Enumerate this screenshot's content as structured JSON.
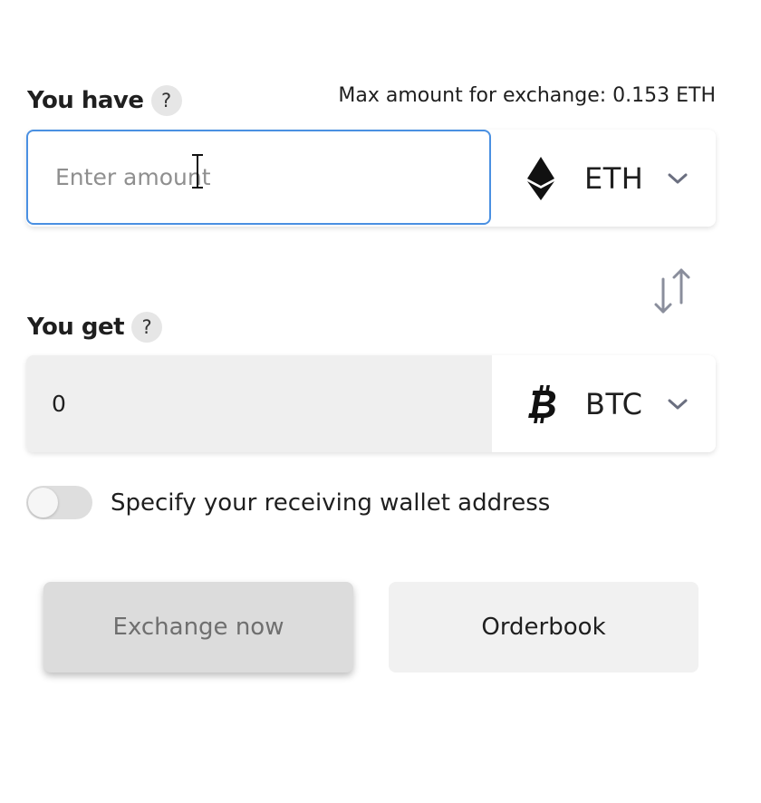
{
  "you_have": {
    "label": "You have",
    "help": "?",
    "max_amount": "Max amount for exchange: 0.153 ETH",
    "input_placeholder": "Enter amount",
    "input_value": "",
    "currency": {
      "code": "ETH",
      "icon": "ethereum-icon"
    }
  },
  "you_get": {
    "label": "You get",
    "help": "?",
    "amount": "0",
    "currency": {
      "code": "BTC",
      "icon": "bitcoin-icon"
    }
  },
  "swap": {
    "icon": "swap-arrows-icon"
  },
  "wallet_toggle": {
    "label": "Specify your receiving wallet address",
    "enabled": false
  },
  "buttons": {
    "exchange_label": "Exchange now",
    "orderbook_label": "Orderbook"
  },
  "colors": {
    "input_focus_border": "#4a90e2",
    "disabled_button_bg": "#dcdcdc",
    "secondary_button_bg": "#f1f1f1"
  }
}
